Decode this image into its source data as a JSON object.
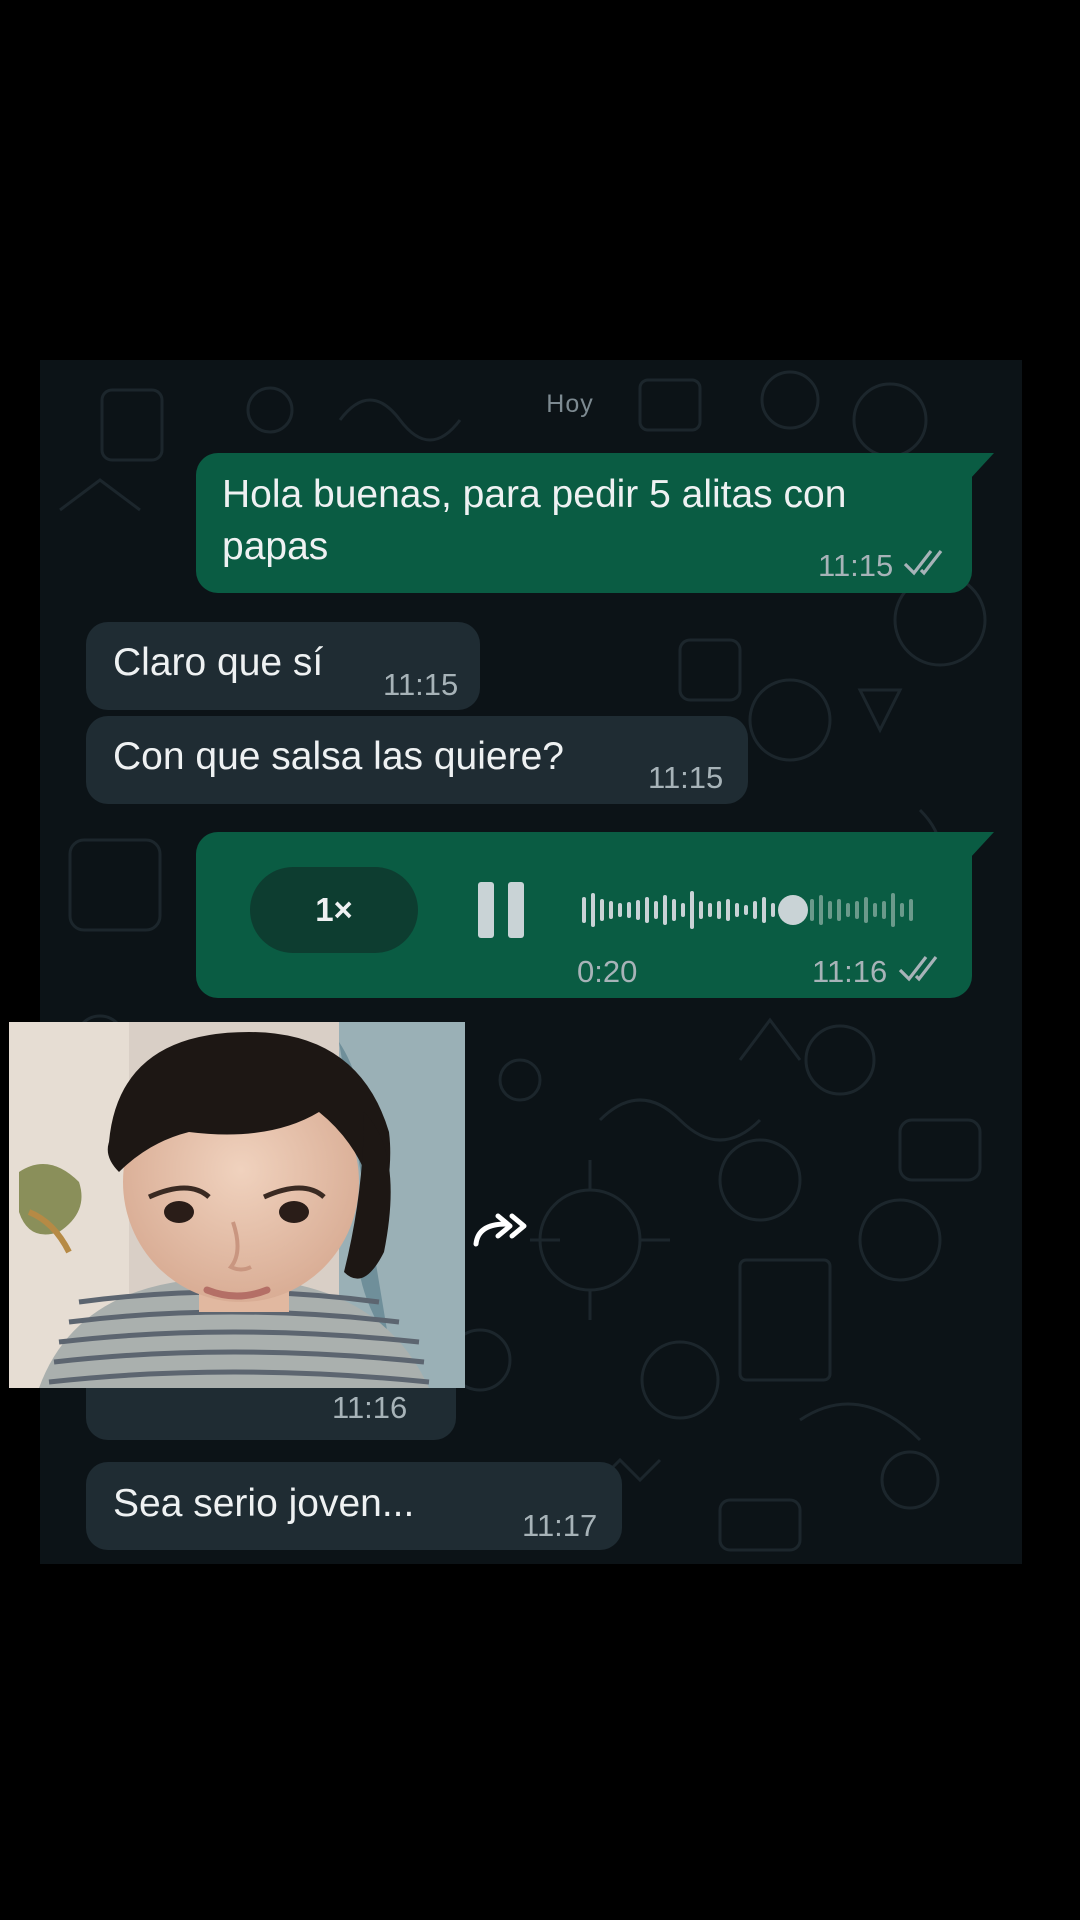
{
  "chat": {
    "day_label": "Hoy",
    "messages": [
      {
        "direction": "outgoing",
        "text_line1": "Hola buenas, para pedir 5 alitas con",
        "text_line2": "papas",
        "time": "11:15",
        "status": "read"
      },
      {
        "direction": "incoming",
        "text": "Claro que sí",
        "time": "11:15"
      },
      {
        "direction": "incoming",
        "text": "Con que salsa las quiere?",
        "time": "11:15"
      },
      {
        "direction": "outgoing",
        "type": "voice",
        "speed": "1×",
        "duration": "0:20",
        "time": "11:16",
        "status": "read",
        "playing": true,
        "progress": 0.58
      },
      {
        "direction": "incoming",
        "type": "image",
        "time": "11:16"
      },
      {
        "direction": "incoming",
        "text": "Sea serio joven...",
        "time": "11:17"
      }
    ]
  },
  "icons": {
    "read_ticks": "double-check-icon",
    "pause": "pause-icon",
    "forward": "forward-icon"
  },
  "colors": {
    "outgoing_bubble": "#0a5c43",
    "incoming_bubble": "#1f2c33",
    "chat_background": "#0c1317",
    "read_ticks": "#a7b3b8"
  }
}
